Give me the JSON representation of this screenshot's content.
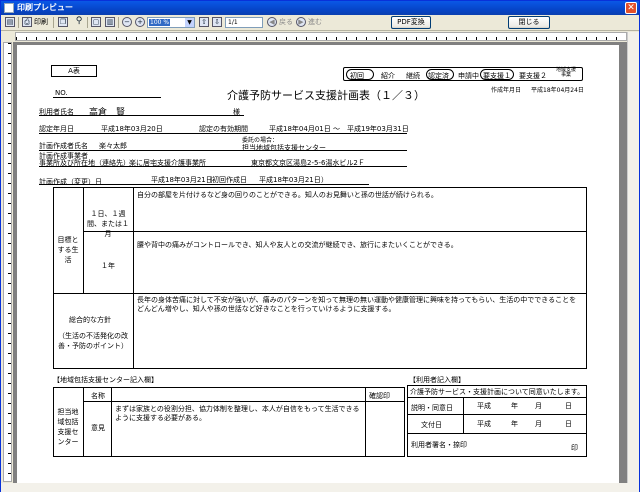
{
  "window": {
    "title": "印刷プレビュー",
    "close": "✕"
  },
  "toolbar": {
    "print_label": "印刷",
    "zoom_value": "100 %",
    "page_value": "1/1",
    "back_label": "戻る",
    "forward_label": "進む",
    "pdf_button": "PDF変換",
    "close_button": "閉じる"
  },
  "doc": {
    "form_label": "A表",
    "no_label": "NO.",
    "main_title": "介護予防サービス支援計画表（１／３）",
    "categories": [
      "初回",
      "紹介",
      "継続",
      "認定済",
      "申請中",
      "要支援１",
      "要支援２",
      "地域支援事業"
    ],
    "created_label": "作成年月日",
    "created_value": "平成18年04月24日",
    "user_label": "利用者氏名",
    "user_name": "高倉　賢",
    "sama": "様",
    "cert_label": "認定年月日",
    "cert_value": "平成18年03月20日",
    "valid_label": "認定の有効期間",
    "valid_from": "平成18年04月01日",
    "tilde": "～",
    "valid_to": "平成19年03月31日",
    "planner_label": "計画作成者氏名",
    "planner_name": "楽々太郎",
    "delegate_note": "委託の場合：",
    "center_name": "担当地域包括支援センター",
    "office_label1": "計画作成事業者",
    "office_label2": "事業所及び所在地（連絡先）",
    "office_name": "楽に居宅支援介護事業所",
    "office_address": "東京都文京区湯島2-5-6湯水ビル2Ｆ",
    "plan_date_label": "計画作成（変更）日",
    "plan_date_value": "平成18年03月21日",
    "initial_label": "（初回作成日",
    "initial_value": "平成18年03月21日",
    "initial_close": "）",
    "goal_label": "目標とする生活",
    "term1_label": "１日、１週間、または１月",
    "term1_text": "自分の部屋を片付けるなど身の回りのことができる。知人のお見舞いと孫の世話が続けられる。",
    "term2_label": "１年",
    "term2_text": "腰や背中の痛みがコントロールでき、知人や友人との交流が継続でき、旅行にまたいくことができる。",
    "policy_label1": "総合的な方針",
    "policy_label2": "（生活の不活発化の改善・予防のポイント）",
    "policy_text": "長年の身体苦痛に対して不安が強いが、痛みのパターンを知って無理の無い運動や健康管理に興味を持ってもらい、生活の中でできることをどんどん増やし、知人や孫の世話など好きなことを行っていけるように支援する。",
    "center_entry_title": "【地域包括支援センター記入欄】",
    "center_col_name": "名称",
    "center_col_check": "確認印",
    "center_row_label": "担当地域包括支援センター",
    "center_opinion_label": "意見",
    "center_opinion_text": "まずは家族との役割分担、協力体制を整理し、本人が自信をもって生活できるように支援する必要がある。",
    "user_entry_title": "【利用者記入欄】",
    "user_consent": "介護予防サービス・支援計画について同意いたします。",
    "explain_label": "説明・同意日",
    "issue_label": "文付日",
    "heisei": "平成",
    "year": "年",
    "month": "月",
    "day": "日",
    "sign_label": "利用者署名・捺印",
    "seal": "印"
  }
}
